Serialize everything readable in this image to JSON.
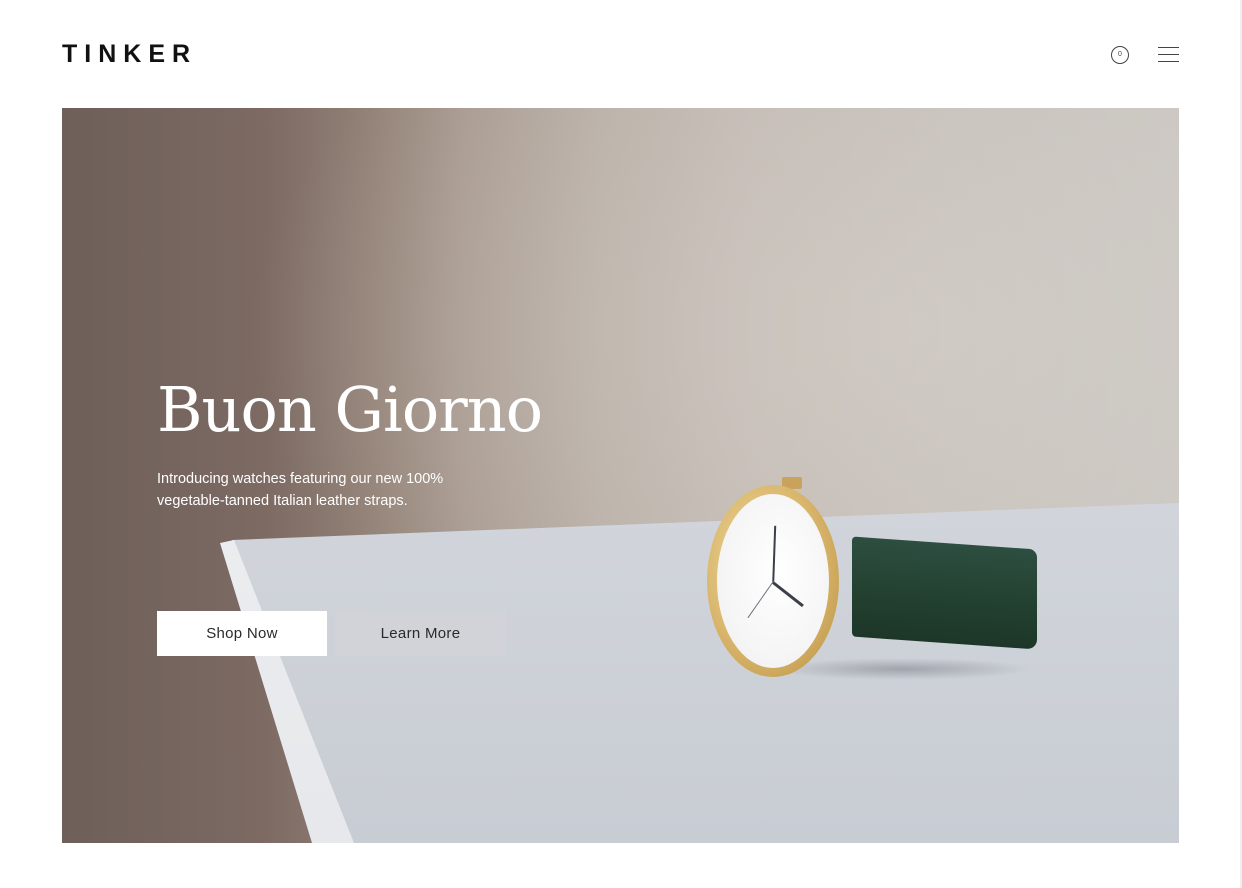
{
  "header": {
    "logo": "TINKER",
    "cart": {
      "icon": "cart-icon",
      "count": "0"
    },
    "menu": {
      "icon": "hamburger-menu-icon"
    }
  },
  "hero": {
    "title": "Buon Giorno",
    "subtitle": "Introducing watches featuring our new 100% vegetable-tanned Italian leather straps.",
    "primary_button": "Shop Now",
    "secondary_button": "Learn More",
    "image": "gold-watch-green-strap-photo"
  },
  "colors": {
    "text_dark": "#111111",
    "hero_text": "#ffffff",
    "strap_green": "#22402f",
    "case_gold": "#d7b46a",
    "learn_button_bg": "#d1d3d8"
  }
}
